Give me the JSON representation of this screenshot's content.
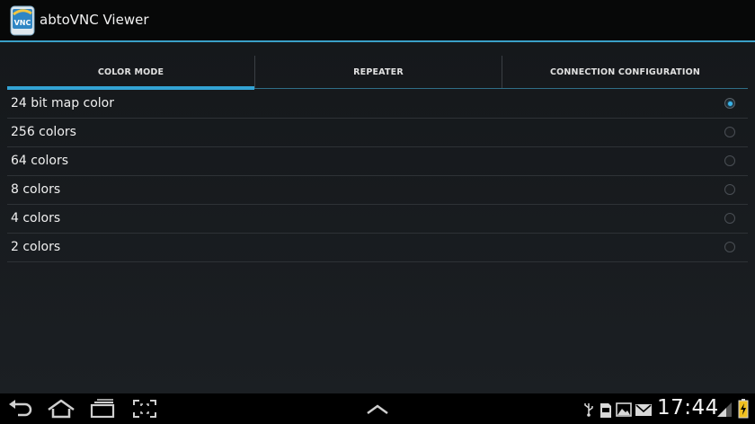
{
  "app": {
    "title": "abtoVNC Viewer",
    "icon": "abtovnc-app-icon",
    "accent_color": "#33a3d4"
  },
  "tabs": [
    {
      "label": "COLOR MODE",
      "selected": true
    },
    {
      "label": "REPEATER",
      "selected": false
    },
    {
      "label": "CONNECTION CONFIGURATION",
      "selected": false
    }
  ],
  "color_modes": [
    {
      "label": "24 bit map color",
      "selected": true
    },
    {
      "label": "256 colors",
      "selected": false
    },
    {
      "label": "64 colors",
      "selected": false
    },
    {
      "label": "8 colors",
      "selected": false
    },
    {
      "label": "4 colors",
      "selected": false
    },
    {
      "label": "2 colors",
      "selected": false
    }
  ],
  "system_bar": {
    "nav_icons": [
      "back-icon",
      "home-icon",
      "recent-apps-icon",
      "screenshot-icon",
      "chevron-up-icon"
    ],
    "status_icons": [
      "usb-icon",
      "sd-card-icon",
      "gallery-icon",
      "gmail-icon",
      "signal-icon",
      "battery-icon"
    ],
    "clock": "17:44"
  }
}
